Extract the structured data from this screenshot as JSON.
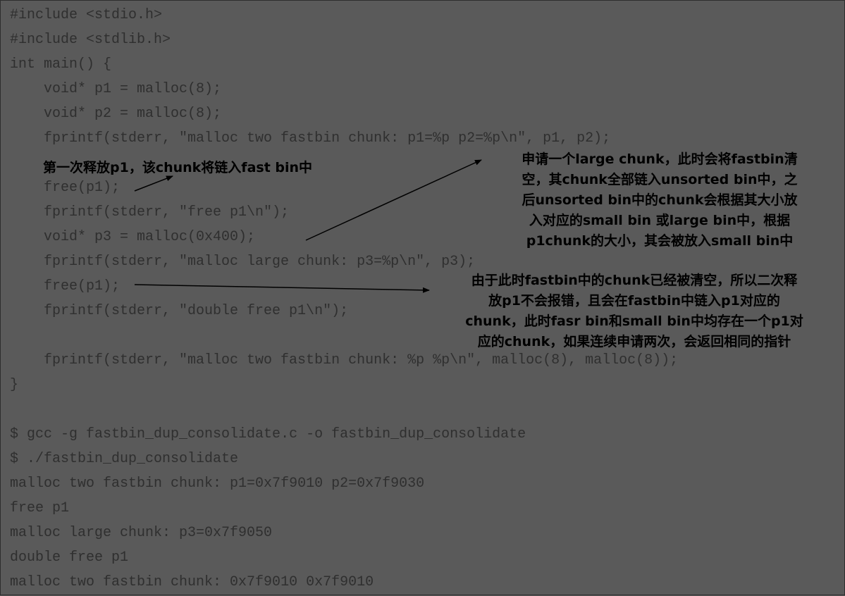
{
  "source_code": [
    "#include <stdio.h>",
    "#include <stdlib.h>",
    "int main() {",
    "void* p1 = malloc(8);",
    "void* p2 = malloc(8);",
    "fprintf(stderr, \"malloc two fastbin chunk: p1=%p p2=%p\\n\", p1, p2);",
    "free(p1);",
    "fprintf(stderr, \"free p1\\n\");",
    "void* p3 = malloc(0x400);",
    "fprintf(stderr, \"malloc large chunk: p3=%p\\n\", p3);",
    "free(p1);",
    "fprintf(stderr, \"double free p1\\n\");",
    "fprintf(stderr, \"malloc two fastbin chunk: %p %p\\n\", malloc(8), malloc(8));",
    "}"
  ],
  "terminal": [
    "$ gcc -g fastbin_dup_consolidate.c -o fastbin_dup_consolidate",
    "$ ./fastbin_dup_consolidate",
    "malloc two fastbin chunk: p1=0x7f9010 p2=0x7f9030",
    "free p1",
    "malloc large chunk: p3=0x7f9050",
    "double free p1",
    "malloc two fastbin chunk: 0x7f9010 0x7f9010"
  ],
  "annotations": {
    "first_free": "第一次释放p1，该chunk将链入fast bin中",
    "large_malloc": [
      "申请一个large chunk，此时会将fastbin清",
      "空，其chunk全部链入unsorted bin中，之",
      "后unsorted bin中的chunk会根据其大小放",
      "入对应的small bin 或large bin中，根据",
      "p1chunk的大小，其会被放入small bin中"
    ],
    "second_free": [
      "由于此时fastbin中的chunk已经被清空，所以二次释",
      "放p1不会报错，且会在fastbin中链入p1对应的",
      "chunk，此时fasr bin和small bin中均存在一个p1对",
      "应的chunk，如果连续申请两次，会返回相同的指针"
    ]
  },
  "colors": {
    "background": "#5a5a5a",
    "code_text": "#2f2f2f",
    "annotation_text": "#000000",
    "arrow": "#000000"
  }
}
